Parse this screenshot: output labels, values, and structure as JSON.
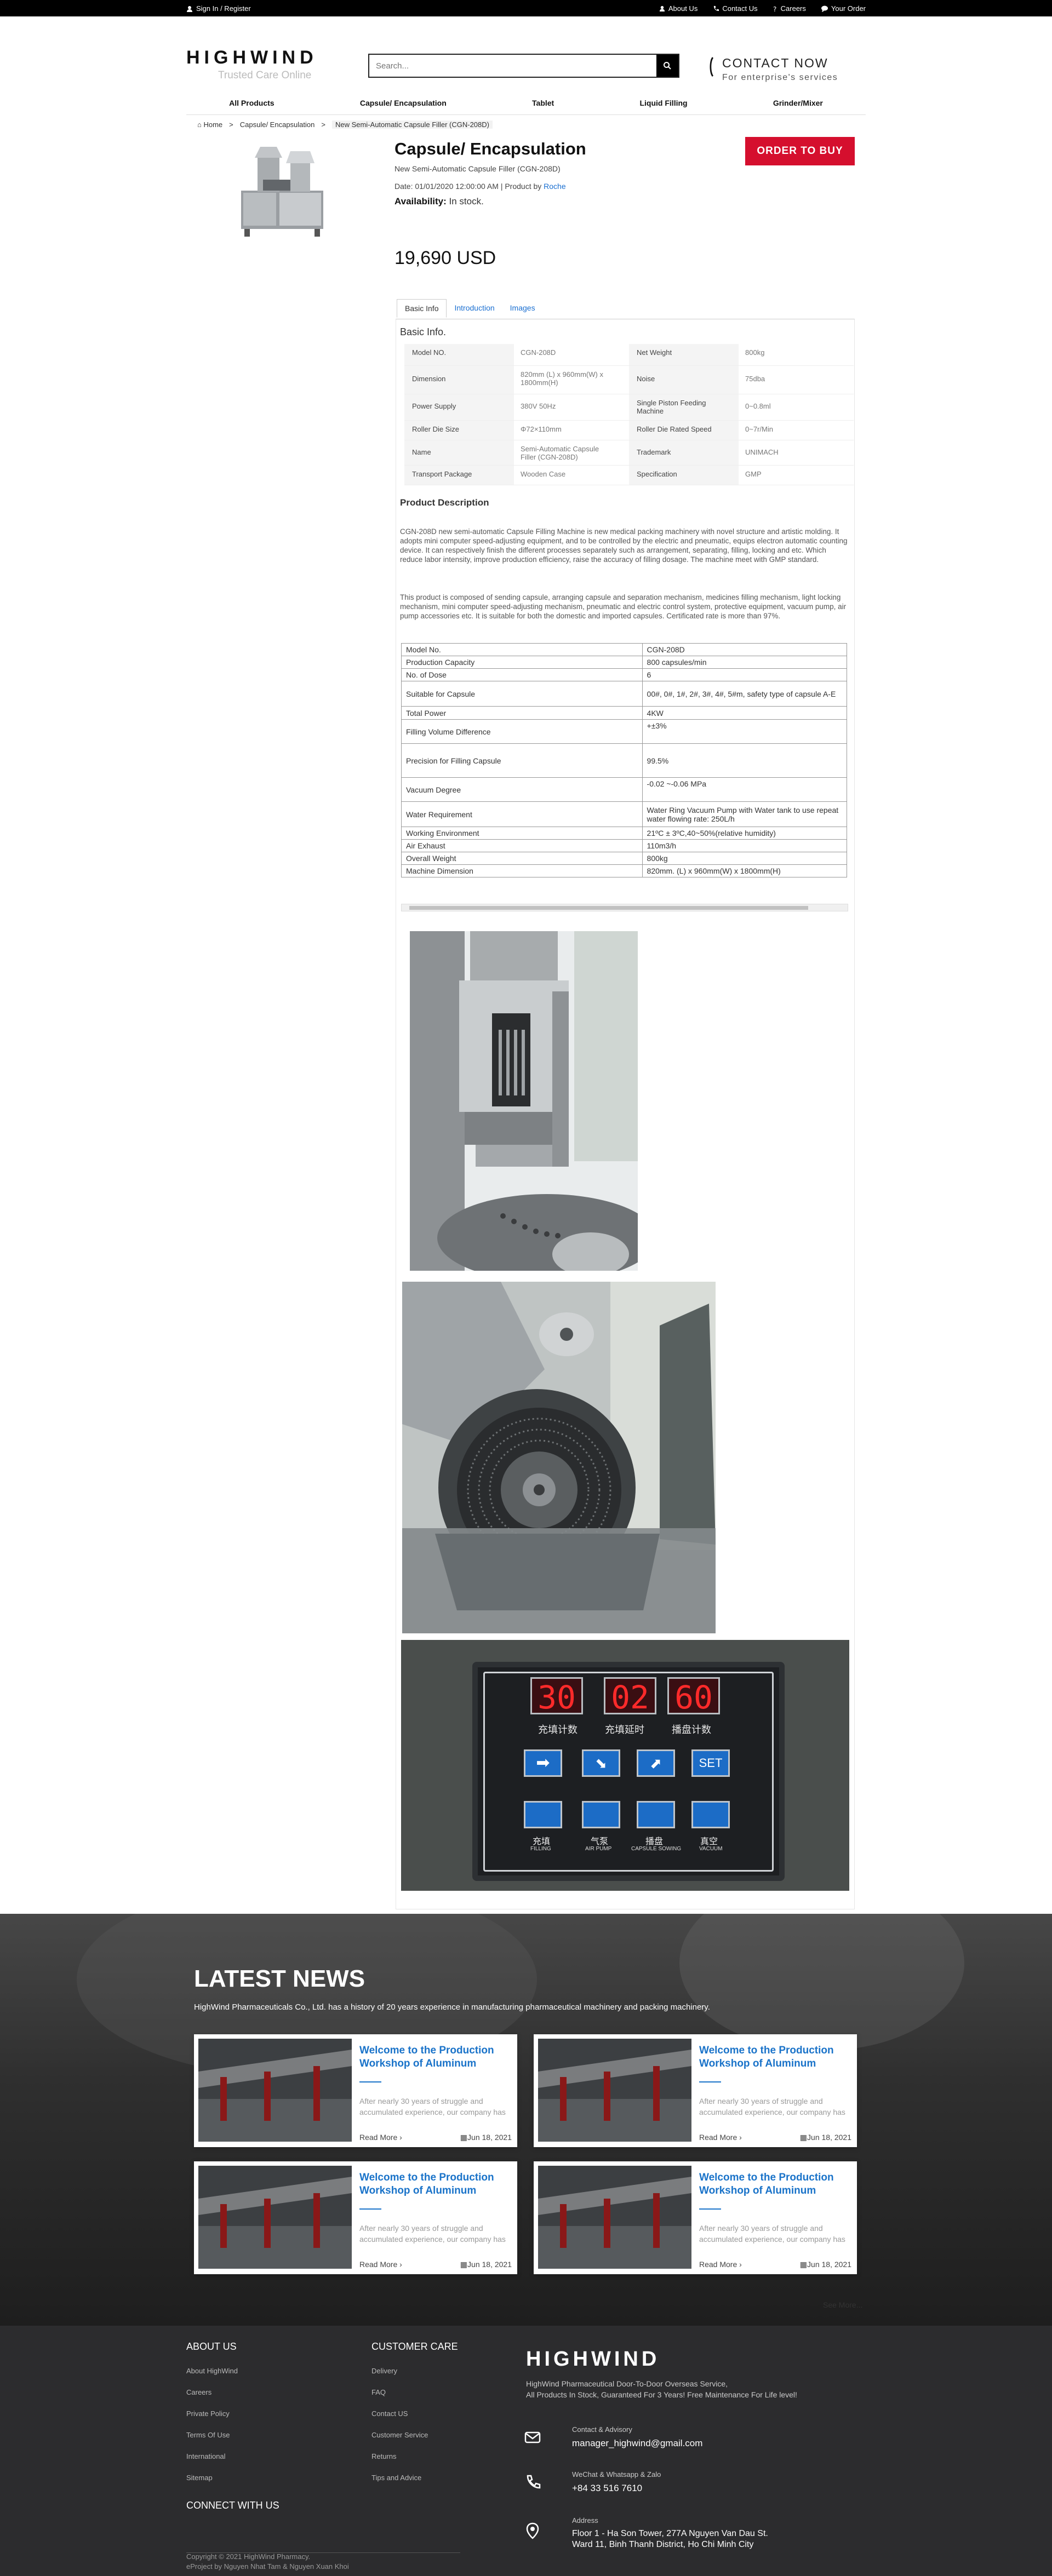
{
  "topbar": {
    "signin": "Sign In / Register",
    "about": "About Us",
    "contact": "Contact Us",
    "careers": "Careers",
    "order": "Your Order"
  },
  "header": {
    "logo_main": "HIGHWIND",
    "logo_tag": "Trusted Care Online",
    "search_placeholder": "Search...",
    "contact_title": "CONTACT NOW",
    "contact_sub": "For enterprise's services"
  },
  "nav": [
    "All Products",
    "Capsule/ Encapsulation",
    "Tablet",
    "Liquid Filling",
    "Grinder/Mixer"
  ],
  "breadcrumb": {
    "home": "Home",
    "sep": ">",
    "category": "Capsule/ Encapsulation",
    "current": "New Semi-Automatic Capsule Filler (CGN-208D)"
  },
  "product": {
    "title": "Capsule/ Encapsulation",
    "subtitle": "New Semi-Automatic Capsule Filler (CGN-208D)",
    "date_text": "Date: 01/01/2020 12:00:00 AM | Product by",
    "brand": "Roche",
    "avail_label": "Availability:",
    "avail_value": "In stock.",
    "order_button": "ORDER TO BUY",
    "price": "19,690 USD"
  },
  "tabs": [
    "Basic Info",
    "Introduction",
    "Images"
  ],
  "basic_info": {
    "heading": "Basic Info.",
    "rows": [
      [
        {
          "k": "Model NO.",
          "v": "CGN-208D"
        },
        {
          "k": "Net Weight",
          "v": "800kg"
        }
      ],
      [
        {
          "k": "Dimension",
          "v": "820mm (L) x 960mm(W) x 1800mm(H)"
        },
        {
          "k": "Noise",
          "v": "75dba"
        }
      ],
      [
        {
          "k": "Power Supply",
          "v": "380V 50Hz"
        },
        {
          "k": "Single Piston Feeding Machine",
          "v": "0~0.8ml"
        }
      ],
      [
        {
          "k": "Roller Die Size",
          "v": "Φ72×110mm"
        },
        {
          "k": "Roller Die Rated Speed",
          "v": "0~7r/Min"
        }
      ],
      [
        {
          "k": "Name",
          "v": "Semi-Automatic Capsule Filler (CGN-208D)"
        },
        {
          "k": "Trademark",
          "v": "UNIMACH"
        }
      ],
      [
        {
          "k": "Transport Package",
          "v": "Wooden Case"
        },
        {
          "k": "Specification",
          "v": "GMP"
        }
      ]
    ]
  },
  "description": {
    "heading": "Product Description",
    "p1": "CGN-208D new semi-automatic Capsule Filling Machine is new medical packing machinery with novel structure and artistic molding. It adopts mini computer speed-adjusting equipment, and to be controlled by the electric and pneumatic, equips electron automatic counting device. It can respectively finish the different processes separately such as arrangement, separating, filling, locking and etc. Which reduce labor intensity, improve production efficiency, raise the accuracy of filling dosage. The machine meet with GMP standard.",
    "p2": "This product is composed of sending capsule, arranging capsule and separation mechanism, medicines filling mechanism, light locking mechanism, mini computer speed-adjusting mechanism, pneumatic and electric control system, protective equipment, vacuum pump, air pump accessories etc. It is suitable for both the domestic and imported capsules. Certificated rate is more than 97%."
  },
  "spec_table": [
    {
      "k": "Model No.",
      "v": "CGN-208D"
    },
    {
      "k": "Production Capacity",
      "v": "800 capsules/min"
    },
    {
      "k": "No. of Dose",
      "v": "6"
    },
    {
      "k": "Suitable for Capsule",
      "v": "00#, 0#, 1#, 2#, 3#, 4#, 5#m, safety type of capsule A-E"
    },
    {
      "k": "Total Power",
      "v": "4KW"
    },
    {
      "k": "Filling Volume Difference",
      "v": "+±3%"
    },
    {
      "k": "Precision for Filling Capsule",
      "v": "99.5%"
    },
    {
      "k": "Vacuum Degree",
      "v": "-0.02 ~-0.06 MPa"
    },
    {
      "k": "Water Requirement",
      "v": "Water Ring Vacuum Pump with Water tank to use repeat water flowing rate: 250L/h"
    },
    {
      "k": "Working Environment",
      "v": "21ºC ± 3ºC,40~50%(relative humidity)"
    },
    {
      "k": "Air Exhaust",
      "v": "110m3/h"
    },
    {
      "k": "Overall Weight",
      "v": "800kg"
    },
    {
      "k": "Machine Dimension",
      "v": "820mm. (L) x 960mm(W) x 1800mm(H)"
    }
  ],
  "panel_display": {
    "counters": [
      "30",
      "02",
      "60"
    ],
    "counter_labels": [
      "充填计数",
      "充填延时",
      "播盘计数"
    ],
    "set_label": "SET",
    "btn_labels": [
      "充填",
      "气泵",
      "播盘",
      "真空"
    ],
    "btn_en": [
      "FILLING",
      "AIR PUMP",
      "CAPSULE SOWING",
      "VACUUM"
    ]
  },
  "news": {
    "heading": "LATEST NEWS",
    "intro": "HighWind Pharmaceuticals Co., Ltd. has a history of 20 years experience in manufacturing pharmaceutical machinery and packing machinery.",
    "cards": [
      {
        "title": "Welcome to the Production Workshop of Aluminum",
        "desc": "After nearly 30 years of struggle and accumulated experience, our company has",
        "more": "Read More ›",
        "date": "Jun 18, 2021"
      },
      {
        "title": "Welcome to the Production Workshop of Aluminum",
        "desc": "After nearly 30 years of struggle and accumulated experience, our company has",
        "more": "Read More ›",
        "date": "Jun 18, 2021"
      },
      {
        "title": "Welcome to the Production Workshop of Aluminum",
        "desc": "After nearly 30 years of struggle and accumulated experience, our company has",
        "more": "Read More ›",
        "date": "Jun 18, 2021"
      },
      {
        "title": "Welcome to the Production Workshop of Aluminum",
        "desc": "After nearly 30 years of struggle and accumulated experience, our company has",
        "more": "Read More ›",
        "date": "Jun 18, 2021"
      }
    ],
    "see_more": "See More..."
  },
  "footer": {
    "about_head": "ABOUT US",
    "about_links": [
      "About HighWind",
      "Careers",
      "Private Policy",
      "Terms Of Use",
      "International",
      "Sitemap"
    ],
    "care_head": "CUSTOMER CARE",
    "care_links": [
      "Delivery",
      "FAQ",
      "Contact US",
      "Customer Service",
      "Returns",
      "Tips and Advice"
    ],
    "connect_head": "CONNECT WITH US",
    "brand": "HIGHWIND",
    "brand_desc1": "HighWind Pharmaceutical Door-To-Door Overseas Service,",
    "brand_desc2": "All Products In Stock, Guaranteed For 3 Years! Free Maintenance For Life level!",
    "email_label": "Contact & Advisory",
    "email": "manager_highwind@gmail.com",
    "phone_label": "WeChat & Whatsapp & Zalo",
    "phone": "+84 33 516 7610",
    "addr_label": "Address",
    "addr1": "Floor 1 - Ha Son Tower, 277A Nguyen Van Dau St.",
    "addr2": "Ward 11, Binh Thanh District, Ho Chi Minh City",
    "copy1": "Copyright © 2021 HighWind Pharmacy.",
    "copy2": "eProject by Nguyen Nhat Tam & Nguyen Xuan Khoi"
  }
}
